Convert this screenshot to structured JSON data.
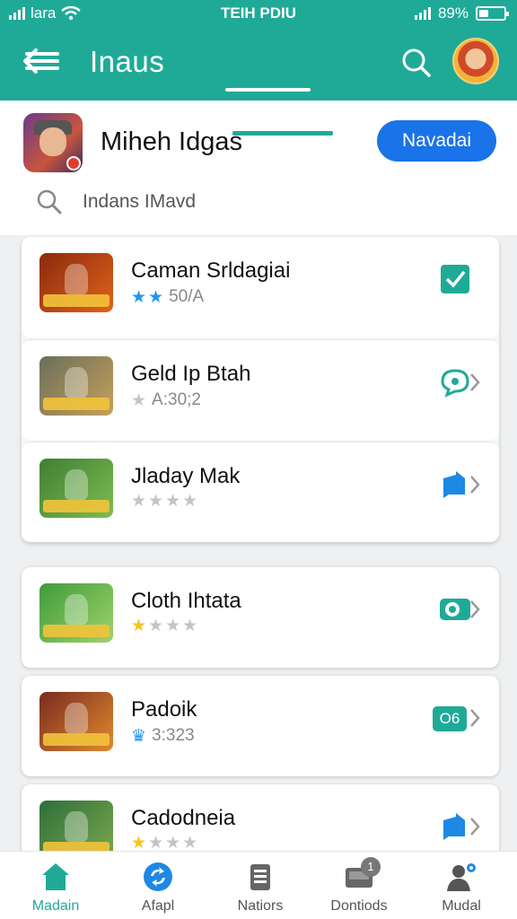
{
  "status_bar": {
    "carrier": "lara",
    "center_text": "TEIH PDIU",
    "battery": "89%"
  },
  "appbar": {
    "title": "Inaus",
    "back_icon": "back-arrow-icon",
    "search_icon": "search-icon"
  },
  "profile": {
    "name": "Miheh Idgas",
    "button_label": "Navadai"
  },
  "search": {
    "text": "Indans IMavd"
  },
  "colors": {
    "header": "#1faa98",
    "accent_blue": "#1a73e8",
    "star_blue": "#2196f3",
    "star_yellow": "#f5c518",
    "star_grey": "#c4c4c4",
    "action_teal": "#1faa98",
    "action_blue": "#1e88e5"
  },
  "list_group": [
    {
      "title": "Caman Srldagiai",
      "sub": "50/A",
      "stars": [
        "blue",
        "blue"
      ],
      "action_icon": "checkbox-checked-icon",
      "icon_colors": [
        "#8a2a0d",
        "#e2621b"
      ]
    },
    {
      "title": "Geld Ip Btah",
      "sub": "A:30;2",
      "stars": [
        "grey"
      ],
      "action_icon": "chat-bubble-icon",
      "icon_colors": [
        "#6a6f5a",
        "#c7a05a"
      ]
    },
    {
      "title": "Jladay Mak",
      "sub": "",
      "stars": [
        "grey",
        "grey",
        "grey",
        "grey"
      ],
      "action_icon": "flag-icon",
      "icon_colors": [
        "#3f7f34",
        "#7dbd4f"
      ]
    }
  ],
  "list_cards": [
    {
      "title": "Cloth Ihtata",
      "sub": "",
      "stars": [
        "yellow",
        "grey",
        "grey",
        "grey"
      ],
      "action_icon": "toggle-icon",
      "icon_colors": [
        "#3f9b3b",
        "#9fd36a"
      ]
    },
    {
      "title": "Padoik",
      "sub": "3:323",
      "stars": [
        "blue-crown"
      ],
      "action_icon": "badge-icon",
      "action_text": "O6",
      "icon_colors": [
        "#7a2b1f",
        "#e08a2f"
      ]
    },
    {
      "title": "Cadodneia",
      "sub": "",
      "stars": [
        "yellow",
        "grey",
        "grey",
        "grey"
      ],
      "action_icon": "flag-icon",
      "icon_colors": [
        "#2f6f3a",
        "#7aa84c"
      ]
    }
  ],
  "bottom_nav": [
    {
      "label": "Madain",
      "icon": "home-icon",
      "active": true
    },
    {
      "label": "Afapl",
      "icon": "sync-icon",
      "active": false
    },
    {
      "label": "Natiors",
      "icon": "document-icon",
      "active": false
    },
    {
      "label": "Dontiods",
      "icon": "inbox-icon",
      "active": false,
      "badge": "1"
    },
    {
      "label": "Mudal",
      "icon": "people-settings-icon",
      "active": false
    }
  ]
}
